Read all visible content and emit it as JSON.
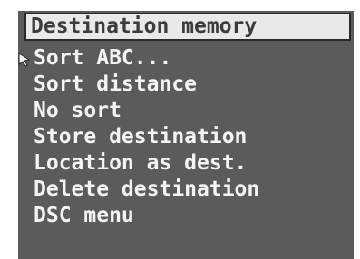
{
  "menu": {
    "title": "Destination memory",
    "items": [
      {
        "label": "Sort ABC...",
        "selected": true
      },
      {
        "label": "Sort distance",
        "selected": false
      },
      {
        "label": "No sort",
        "selected": false
      },
      {
        "label": "Store destination",
        "selected": false
      },
      {
        "label": "Location as dest.",
        "selected": false
      },
      {
        "label": "Delete destination",
        "selected": false
      },
      {
        "label": "DSC menu",
        "selected": false
      }
    ]
  },
  "icons": {
    "selection_cursor": "pointer-arrow-icon"
  },
  "colors": {
    "screen_background": "#5b5b5b",
    "title_background": "#e9e9e9",
    "title_text": "#3c3c3c",
    "item_text": "#f4f4f4"
  }
}
